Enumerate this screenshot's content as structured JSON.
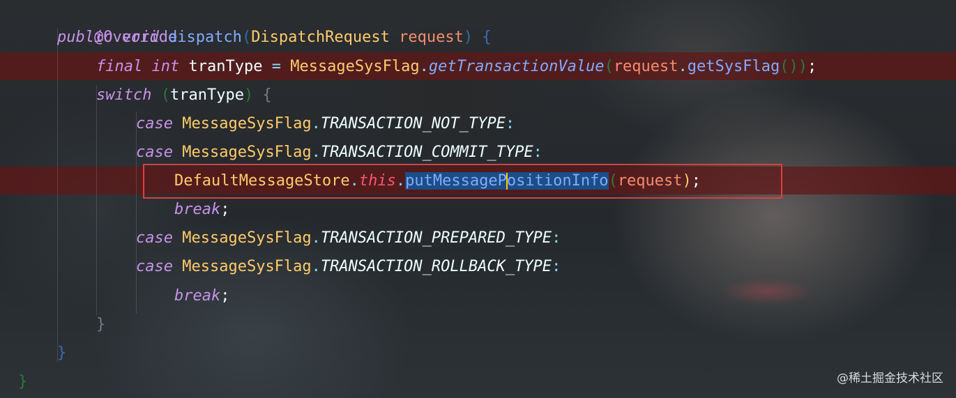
{
  "code": {
    "annotation": "@Override",
    "l2": {
      "public": "public",
      "void": "void",
      "method": "dispatch",
      "open_paren": "(",
      "param_type": "DispatchRequest",
      "param_name": "request",
      "close_paren": ")",
      "brace": "{"
    },
    "l3": {
      "final": "final",
      "int": "int",
      "var": "tranType",
      "eq": "=",
      "cls": "MessageSysFlag",
      "dot1": ".",
      "method": "getTransactionValue",
      "open": "(",
      "arg": "request",
      "dot2": ".",
      "call": "getSysFlag",
      "parens": "()",
      "close": ")",
      "semi": ";"
    },
    "l4": {
      "switch": "switch",
      "open": "(",
      "var": "tranType",
      "close": ")",
      "brace": "{"
    },
    "l5": {
      "case": "case",
      "cls": "MessageSysFlag",
      "dot": ".",
      "const": "TRANSACTION_NOT_TYPE",
      "colon": ":"
    },
    "l6": {
      "case": "case",
      "cls": "MessageSysFlag",
      "dot": ".",
      "const": "TRANSACTION_COMMIT_TYPE",
      "colon": ":"
    },
    "l7": {
      "cls": "DefaultMessageStore",
      "dot1": ".",
      "this": "this",
      "dot2": ".",
      "method_a": "putMessageP",
      "method_b": "ositionInfo",
      "open": "(",
      "arg": "request",
      "close": ")",
      "semi": ";"
    },
    "l8": {
      "break": "break",
      "semi": ";"
    },
    "l9": {
      "case": "case",
      "cls": "MessageSysFlag",
      "dot": ".",
      "const": "TRANSACTION_PREPARED_TYPE",
      "colon": ":"
    },
    "l10": {
      "case": "case",
      "cls": "MessageSysFlag",
      "dot": ".",
      "const": "TRANSACTION_ROLLBACK_TYPE",
      "colon": ":"
    },
    "l11": {
      "break": "break",
      "semi": ";"
    },
    "l12": {
      "brace": "}"
    },
    "l13": {
      "brace": "}"
    },
    "l14": {
      "brace": "}"
    }
  },
  "watermark": "@稀土掘金技术社区",
  "colors": {
    "keyword": "#c792ea",
    "method": "#82aaff",
    "type": "#ffcb6b",
    "param": "#f78c6c",
    "this_keyword": "#ff5370",
    "highlight_box": "#e23c3c",
    "selection": "#1c4d86",
    "breakpoint_row": "#621616"
  }
}
